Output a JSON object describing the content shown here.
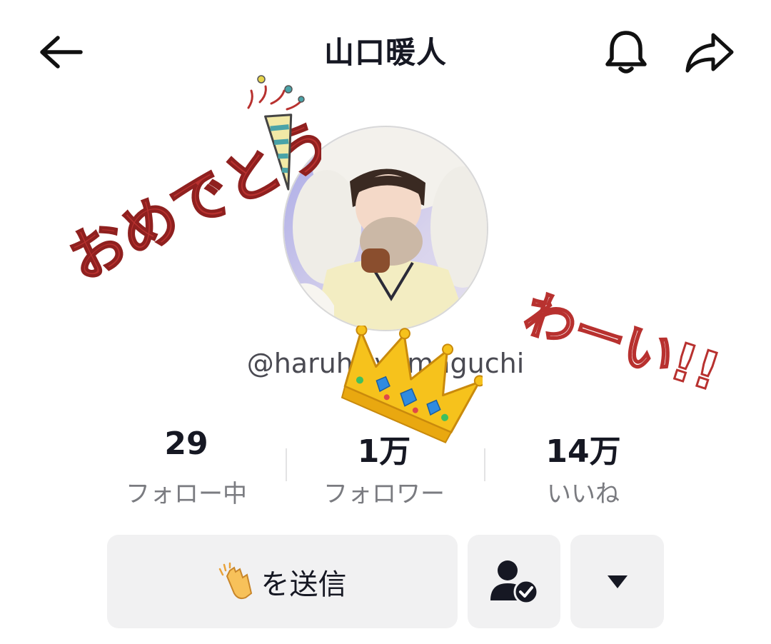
{
  "header": {
    "title": "山口暖人",
    "back_icon": "arrow-left-icon",
    "bell_icon": "bell-icon",
    "share_icon": "share-arrow-icon"
  },
  "profile": {
    "username": "@haruhi_yamaguchi"
  },
  "stats": [
    {
      "value": "29",
      "label": "フォロー中"
    },
    {
      "value": "1万",
      "label": "フォロワー"
    },
    {
      "value": "14万",
      "label": "いいね"
    }
  ],
  "actions": {
    "send_label": "を送信",
    "send_icon": "clapping-hands-icon",
    "friend_icon": "user-check-icon",
    "more_icon": "triangle-down-icon"
  },
  "stickers": {
    "omedetou": "おめでとう",
    "waai": "わーい!!"
  },
  "colors": {
    "sticker_red": "#b8312f",
    "crown_gold": "#f6c21c",
    "button_bg": "#f1f1f2",
    "text_primary": "#161823",
    "text_secondary": "#7a7b80"
  }
}
